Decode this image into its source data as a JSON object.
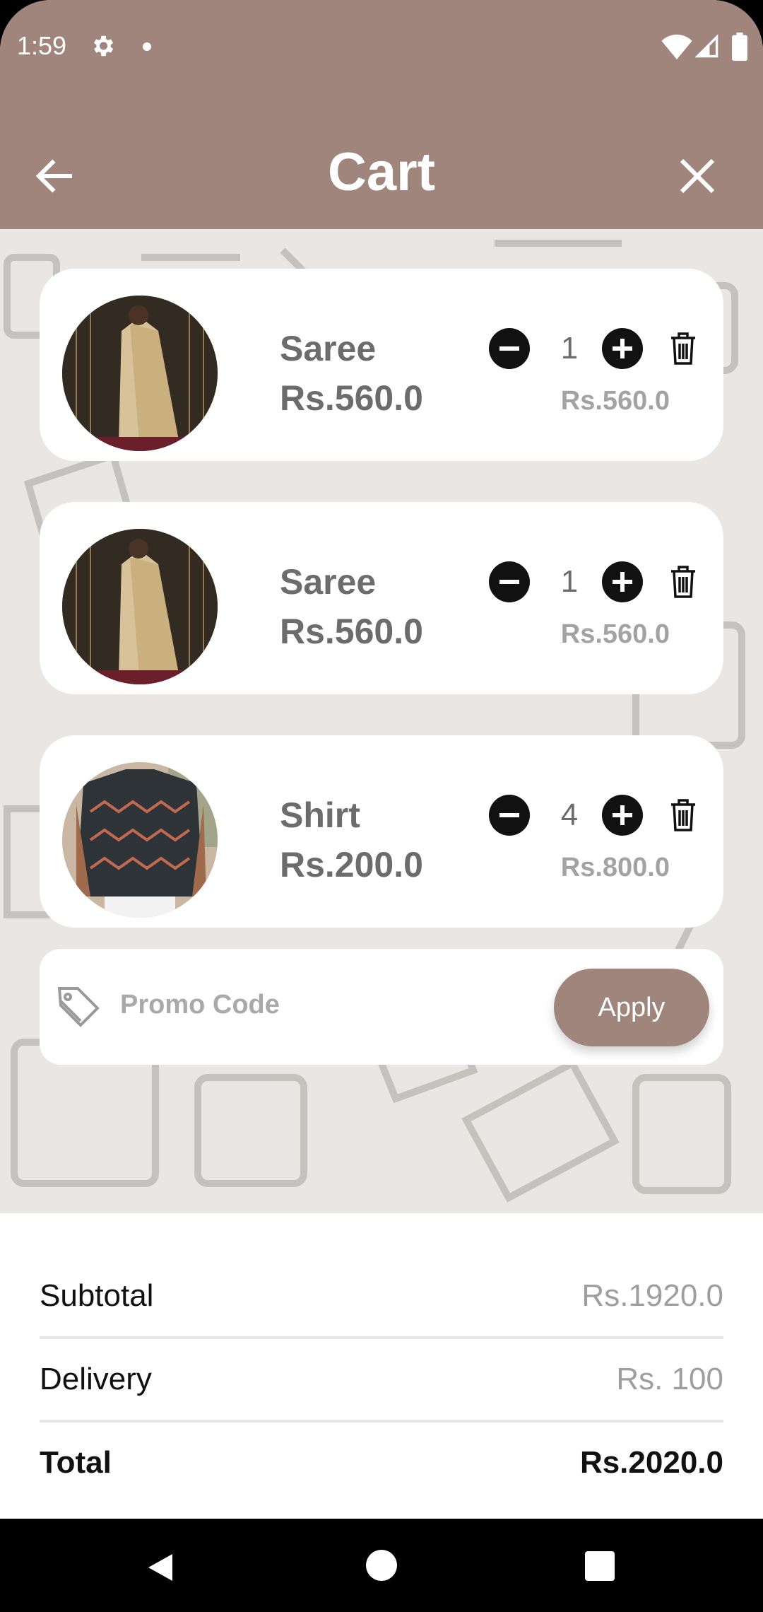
{
  "status_bar": {
    "time": "1:59"
  },
  "header": {
    "title": "Cart"
  },
  "cart_items": [
    {
      "name": "Saree",
      "unit_price": "Rs.560.0",
      "quantity": "1",
      "line_total": "Rs.560.0"
    },
    {
      "name": "Saree",
      "unit_price": "Rs.560.0",
      "quantity": "1",
      "line_total": "Rs.560.0"
    },
    {
      "name": "Shirt",
      "unit_price": "Rs.200.0",
      "quantity": "4",
      "line_total": "Rs.800.0"
    }
  ],
  "promo": {
    "placeholder": "Promo Code",
    "apply_label": "Apply"
  },
  "summary": {
    "subtotal_label": "Subtotal",
    "subtotal_value": "Rs.1920.0",
    "delivery_label": "Delivery",
    "delivery_value": "Rs. 100",
    "total_label": "Total",
    "total_value": "Rs.2020.0"
  },
  "colors": {
    "accent": "#a0857c",
    "background": "#e9e6e3"
  },
  "icons": [
    "back-arrow",
    "close",
    "minus-circle",
    "plus-circle",
    "trash",
    "tag",
    "gear",
    "wifi",
    "signal",
    "battery"
  ]
}
